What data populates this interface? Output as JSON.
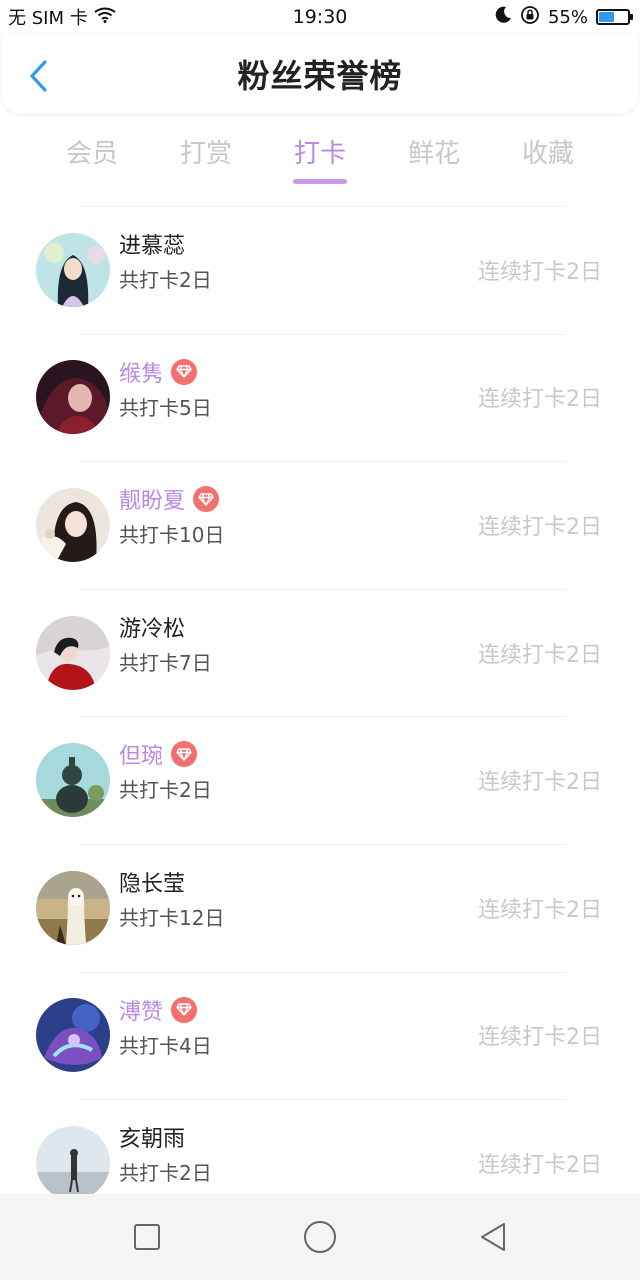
{
  "status_bar": {
    "carrier": "无 SIM 卡",
    "time": "19:30",
    "battery_percent": "55%",
    "battery_level": 0.55,
    "icons": [
      "wifi-icon",
      "moon-icon",
      "rotation-lock-icon",
      "battery-icon"
    ]
  },
  "header": {
    "title": "粉丝荣誉榜",
    "back_icon": "chevron-left-icon"
  },
  "tabs": [
    {
      "label": "会员",
      "active": false
    },
    {
      "label": "打赏",
      "active": false
    },
    {
      "label": "打卡",
      "active": true
    },
    {
      "label": "鲜花",
      "active": false
    },
    {
      "label": "收藏",
      "active": false
    }
  ],
  "list": [
    {
      "name": "进慕蕊",
      "vip": false,
      "total": "共打卡2日",
      "streak": "连续打卡2日"
    },
    {
      "name": "缑隽",
      "vip": true,
      "total": "共打卡5日",
      "streak": "连续打卡2日"
    },
    {
      "name": "靓盼夏",
      "vip": true,
      "total": "共打卡10日",
      "streak": "连续打卡2日"
    },
    {
      "name": "游冷松",
      "vip": false,
      "total": "共打卡7日",
      "streak": "连续打卡2日"
    },
    {
      "name": "但琬",
      "vip": true,
      "total": "共打卡2日",
      "streak": "连续打卡2日"
    },
    {
      "name": "隐长莹",
      "vip": false,
      "total": "共打卡12日",
      "streak": "连续打卡2日"
    },
    {
      "name": "溥赞",
      "vip": true,
      "total": "共打卡4日",
      "streak": "连续打卡2日"
    },
    {
      "name": "亥朝雨",
      "vip": false,
      "total": "共打卡2日",
      "streak": "连续打卡2日"
    }
  ],
  "colors": {
    "accent": "#b88be3",
    "vip_badge": "#f2706f",
    "back_icon": "#2f9bf0",
    "muted": "#c8c8c8"
  },
  "nav_bar": {
    "buttons": [
      "recent-apps-icon",
      "home-icon",
      "back-triangle-icon"
    ]
  }
}
